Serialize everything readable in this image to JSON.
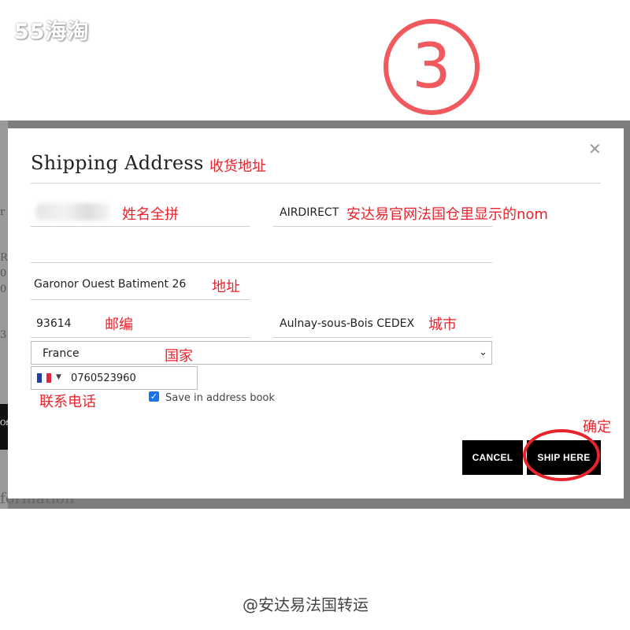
{
  "watermark": "55海淘",
  "step_number": "3",
  "background_fragments": [
    "r",
    "R",
    "0",
    "0",
    "3",
    "Of",
    "formation"
  ],
  "modal": {
    "title": "Shipping Address",
    "close_icon": "close-icon",
    "fields": {
      "name": "",
      "company": "AIRDIRECT",
      "address_line2": "",
      "address": "Garonor Ouest Batiment 26",
      "postcode": "93614",
      "city": "Aulnay-sous-Bois CEDEX",
      "country": "France",
      "phone": "0760523960"
    },
    "flag_icon": "france-flag-icon",
    "save_in_address_book_label": "Save in address book",
    "save_in_address_book_checked": true,
    "cancel_label": "CANCEL",
    "ship_here_label": "SHIP HERE"
  },
  "annotations": {
    "title": "收货地址",
    "name": "姓名全拼",
    "company": "安达易官网法国仓里显示的nom",
    "address": "地址",
    "postcode": "邮编",
    "city": "城市",
    "country": "国家",
    "phone": "联系电话",
    "confirm": "确定"
  },
  "footer_credit": "@安达易法国转运",
  "colors": {
    "annotation_red": "#e8232b",
    "step_circle": "#f0595d",
    "button_bg": "#000000",
    "backdrop": "#7d7d7d",
    "checkbox_blue": "#1a73e8"
  }
}
